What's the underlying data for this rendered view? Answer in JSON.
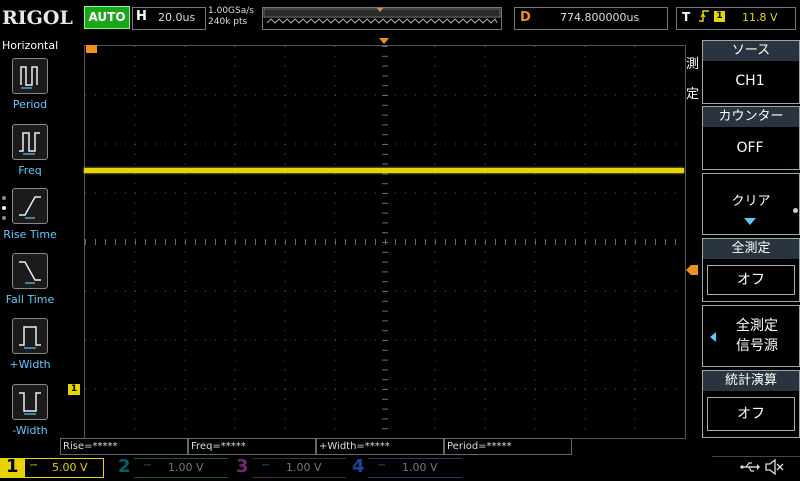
{
  "topbar": {
    "brand": "RIGOL",
    "run_status": "AUTO",
    "timebase_letter": "H",
    "timebase_value": "20.0us",
    "sample_rate": "1.00GSa/s",
    "memory_depth": "240k pts",
    "delay_letter": "D",
    "delay_value": "774.800000us",
    "trigger_letter": "T",
    "trigger_edge_icon": "rising-edge-icon",
    "trigger_channel": "1",
    "trigger_level": "11.8 V"
  },
  "left_menu": {
    "title": "Horizontal",
    "items": [
      {
        "label": "Period",
        "icon": "period-icon"
      },
      {
        "label": "Freq",
        "icon": "freq-icon"
      },
      {
        "label": "Rise Time",
        "icon": "rise-time-icon"
      },
      {
        "label": "Fall Time",
        "icon": "fall-time-icon"
      },
      {
        "label": "+Width",
        "icon": "pos-width-icon"
      },
      {
        "label": "-Width",
        "icon": "neg-width-icon"
      }
    ]
  },
  "right_menu": {
    "side_title": "測定",
    "source_label": "ソース",
    "source_value": "CH1",
    "counter_label": "カウンター",
    "counter_value": "OFF",
    "clear_label": "クリア",
    "all_measure_label": "全測定",
    "all_measure_value": "オフ",
    "all_measure_source_label": "全測定\n信号源",
    "statistics_label": "統計演算",
    "statistics_value": "オフ"
  },
  "measurements": [
    {
      "label": "Rise=*****"
    },
    {
      "label": "Freq=*****"
    },
    {
      "label": "+Width=*****"
    },
    {
      "label": "Period=*****"
    }
  ],
  "channels": [
    {
      "number": "1",
      "scale": "5.00 V",
      "color": "#e8d400",
      "active": true
    },
    {
      "number": "2",
      "scale": "1.00 V",
      "color": "#00a0a8",
      "active": false
    },
    {
      "number": "3",
      "scale": "1.00 V",
      "color": "#c040c8",
      "active": false
    },
    {
      "number": "4",
      "scale": "1.00 V",
      "color": "#3070ff",
      "active": false
    }
  ],
  "waveform": {
    "channel": "1",
    "color": "#e8d400",
    "marker_label": "1"
  },
  "status_icons": [
    "usb-icon",
    "speaker-muted-icon"
  ]
}
